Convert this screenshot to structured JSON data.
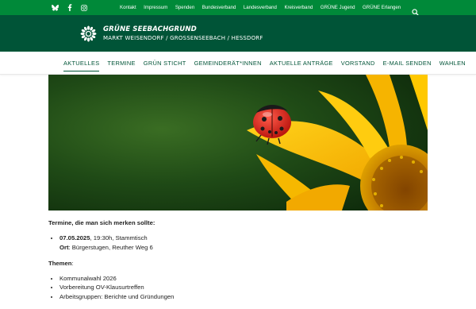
{
  "topbar": {
    "social": [
      "bluesky-icon",
      "facebook-icon",
      "instagram-icon"
    ],
    "links": [
      "Kontakt",
      "Impressum",
      "Spenden",
      "Bundesverband",
      "Landesverband",
      "Kreisverband",
      "GRÜNE Jugend",
      "GRÜNE Erlangen"
    ],
    "search_icon": "search-icon"
  },
  "header": {
    "title": "GRÜNE SEEBACHGRUND",
    "subtitle": "MARKT WEISENDORF / GROSSENSEEBACH / HESSDORF"
  },
  "nav": {
    "items": [
      "AKTUELLES",
      "TERMINE",
      "GRÜN STICHT",
      "GEMEINDERÄT*INNEN",
      "AKTUELLE ANTRÄGE",
      "VORSTAND",
      "E-MAIL SENDEN",
      "WAHLEN"
    ],
    "active": "AKTUELLES"
  },
  "article": {
    "intro": "Termine, die man sich merken sollte:",
    "event_date": "07.05.2025",
    "event_rest": ", 19:30h, Stammtisch",
    "location_label": "Ort",
    "location_value": ": Bürgerstugen, Reuther Weg 6",
    "topics_label": "Themen",
    "topics_colon": ":",
    "topics": [
      "Kommunalwahl 2026",
      "Vorbereitung OV-Klausurtreffen",
      "Arbeitsgruppen: Berichte und Gründungen"
    ]
  },
  "colors": {
    "topbar": "#008939",
    "header": "#005437",
    "nav_text": "#005437"
  }
}
